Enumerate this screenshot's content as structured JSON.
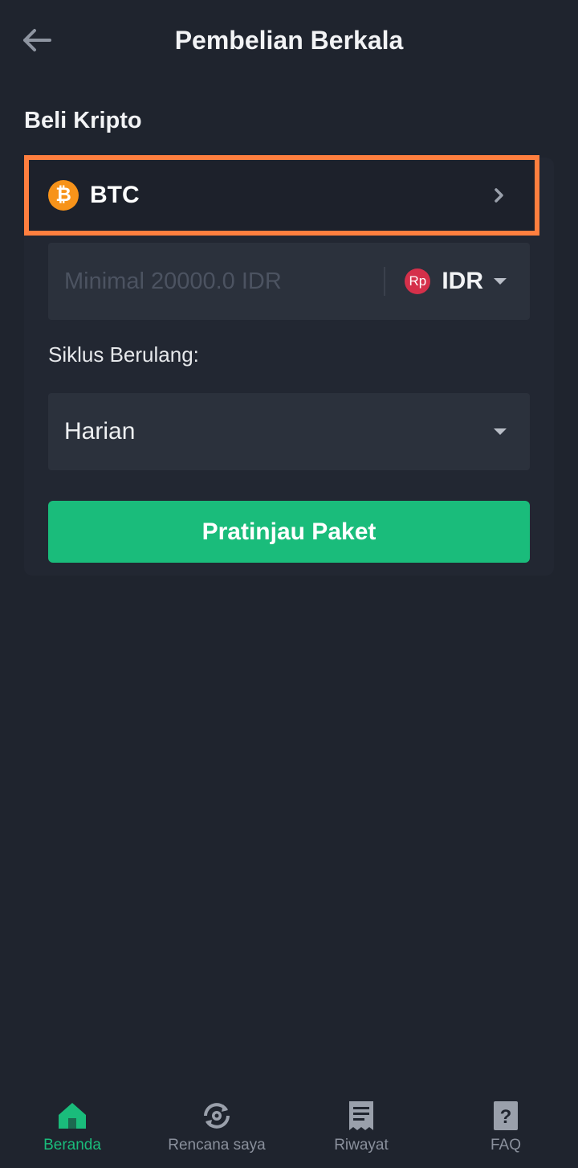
{
  "header": {
    "title": "Pembelian Berkala",
    "back_icon": "arrow-left-icon"
  },
  "section": {
    "label": "Beli Kripto"
  },
  "coin": {
    "symbol": "BTC",
    "icon_glyph": "₿",
    "icon": "bitcoin-icon",
    "icon_color": "#f7931a"
  },
  "amount": {
    "value": "",
    "placeholder": "Minimal 20000.0 IDR",
    "currency": "IDR",
    "currency_icon_text": "Rp",
    "currency_icon_color": "#d5304a"
  },
  "cycle": {
    "label": "Siklus Berulang:",
    "selected": "Harian"
  },
  "action": {
    "preview_label": "Pratinjau Paket",
    "color": "#1abc7b"
  },
  "highlight_color": "#ff7f3f",
  "nav": {
    "items": [
      {
        "label": "Beranda",
        "icon": "home-icon",
        "active": true
      },
      {
        "label": "Rencana saya",
        "icon": "recurring-plan-icon",
        "active": false
      },
      {
        "label": "Riwayat",
        "icon": "receipt-icon",
        "active": false
      },
      {
        "label": "FAQ",
        "icon": "question-doc-icon",
        "active": false
      }
    ]
  }
}
